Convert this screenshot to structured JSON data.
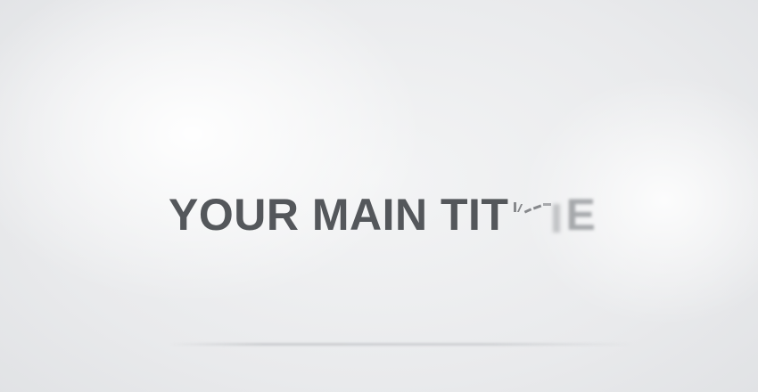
{
  "title": {
    "main_text": "YOUR MAIN TIT",
    "trailing_text": "E"
  },
  "colors": {
    "background": "#e9eaec",
    "title_text": "#54575b",
    "trailing_text": "#8c8f93"
  }
}
